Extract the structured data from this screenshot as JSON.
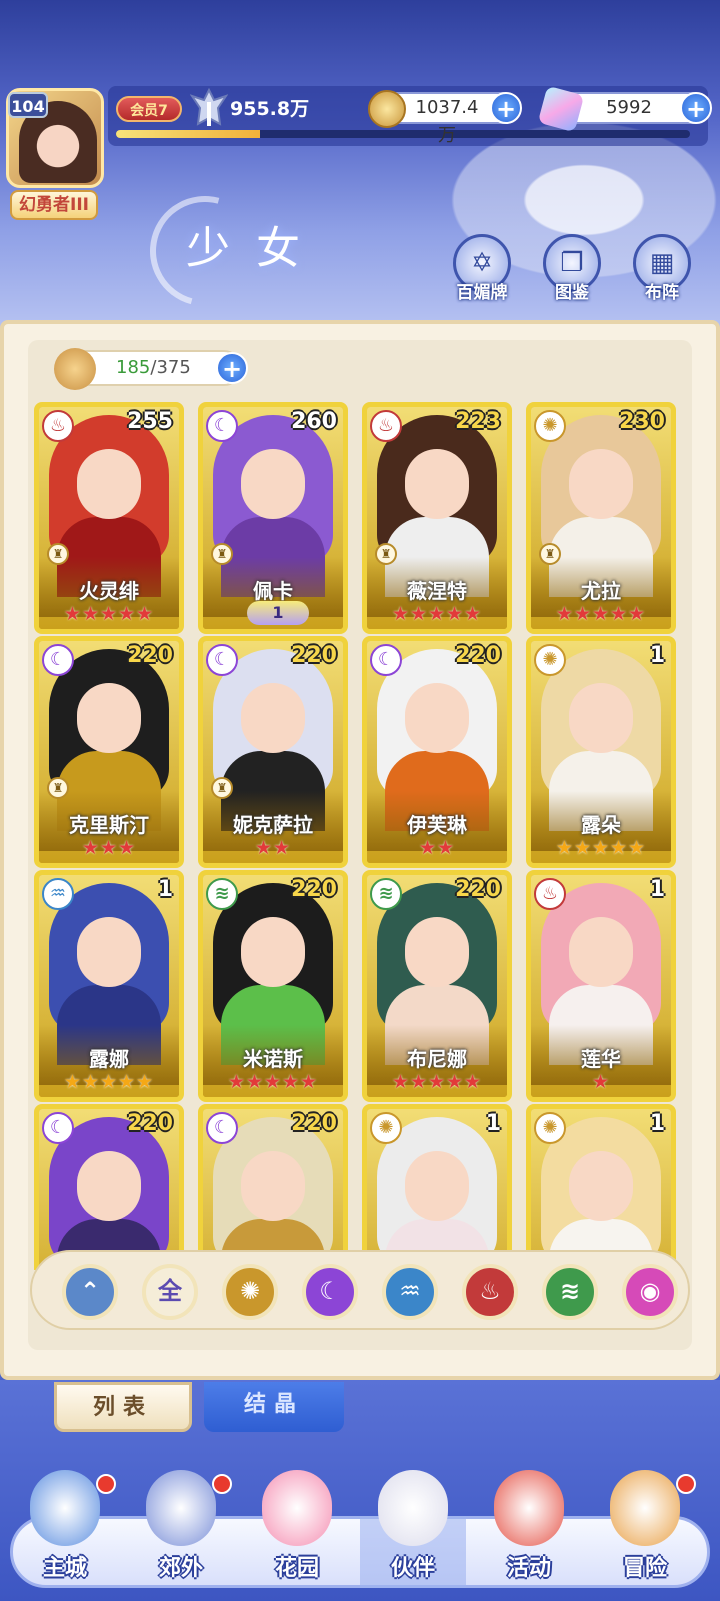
{
  "header": {
    "level": "104",
    "title_badge": "幻勇者III",
    "vip": "会员7",
    "power": "955.8万",
    "exp_progress": 0.25,
    "gold": "1037.4万",
    "gems": "5992",
    "plus": "+"
  },
  "banner": {
    "title": "少女",
    "buttons": [
      {
        "label": "百媚牌",
        "icon": "card-icon"
      },
      {
        "label": "图鉴",
        "icon": "book-icon"
      },
      {
        "label": "布阵",
        "icon": "grid-icon"
      }
    ]
  },
  "capacity": {
    "current": "185",
    "separator": "/",
    "max": "375"
  },
  "elements": {
    "fire": {
      "glyph": "♨",
      "color": "#c23a3a"
    },
    "moon": {
      "glyph": "☾",
      "color": "#8c45d6"
    },
    "sun": {
      "glyph": "✺",
      "color": "#c9972c"
    },
    "water": {
      "glyph": "♒",
      "color": "#3b86c9"
    },
    "wind": {
      "glyph": "≋",
      "color": "#3f9a4c"
    }
  },
  "cards": [
    {
      "name": "火灵绯",
      "level": "255",
      "element": "fire",
      "stars": "★★★★★",
      "star_color": "red",
      "hair": "#d23c2c",
      "outfit": "#a01818"
    },
    {
      "name": "佩卡",
      "level": "260",
      "element": "moon",
      "stars": "",
      "tier": "1",
      "hair": "#8b5ad1",
      "outfit": "#6c3ca6"
    },
    {
      "name": "薇涅特",
      "level": "223",
      "element": "fire",
      "stars": "★★★★★",
      "star_color": "red",
      "hair": "#4a2a1c",
      "outfit": "#eeeeee"
    },
    {
      "name": "尤拉",
      "level": "230",
      "element": "sun",
      "stars": "★★★★★",
      "star_color": "red",
      "hair": "#e8c89a",
      "outfit": "#f4f0e8"
    },
    {
      "name": "克里斯汀",
      "level": "220",
      "element": "moon",
      "stars": "★★★",
      "star_color": "red",
      "hair": "#1e1e1e",
      "outfit": "#c79a1d"
    },
    {
      "name": "妮克萨拉",
      "level": "220",
      "element": "moon",
      "stars": "★★",
      "star_color": "red",
      "hair": "#dcdff0",
      "outfit": "#222222"
    },
    {
      "name": "伊芙琳",
      "level": "220",
      "element": "moon",
      "stars": "★★",
      "star_color": "red",
      "hair": "#f2f2f2",
      "outfit": "#e06b1c"
    },
    {
      "name": "露朵",
      "level": "1",
      "element": "sun",
      "stars": "★★★★★",
      "star_color": "gold",
      "hair": "#eed9a5",
      "outfit": "#f5f1ea"
    },
    {
      "name": "露娜",
      "level": "1",
      "element": "water",
      "stars": "★★★★★",
      "star_color": "gold",
      "hair": "#3c4fb0",
      "outfit": "#2b3688"
    },
    {
      "name": "米诺斯",
      "level": "220",
      "element": "wind",
      "stars": "★★★★★",
      "star_color": "red",
      "hair": "#1c1c1c",
      "outfit": "#5cbf4a"
    },
    {
      "name": "布尼娜",
      "level": "220",
      "element": "wind",
      "stars": "★★★★★",
      "star_color": "red",
      "hair": "#2f5c4f",
      "outfit": "#f3d9c8"
    },
    {
      "name": "莲华",
      "level": "1",
      "element": "fire",
      "stars": "★",
      "star_color": "red",
      "hair": "#f2a9b6",
      "outfit": "#f6f0ee"
    },
    {
      "name": "",
      "level": "220",
      "element": "moon",
      "stars": "",
      "hair": "#7a45c9",
      "outfit": "#3a2a6e"
    },
    {
      "name": "",
      "level": "220",
      "element": "moon",
      "stars": "",
      "hair": "#e6dcb8",
      "outfit": "#c89a3a"
    },
    {
      "name": "",
      "level": "1",
      "element": "sun",
      "stars": "",
      "hair": "#ececec",
      "outfit": "#f2e2e6"
    },
    {
      "name": "",
      "level": "1",
      "element": "sun",
      "stars": "",
      "hair": "#f3dca0",
      "outfit": "#f7f4ef"
    }
  ],
  "filters": [
    {
      "label": "",
      "icon": "up-arrow-icon",
      "color": "#5b88c9"
    },
    {
      "label": "全",
      "icon": "all-icon",
      "color": "#f5edd8"
    },
    {
      "label": "",
      "icon": "sun-icon",
      "color": "#c9972c"
    },
    {
      "label": "",
      "icon": "moon-icon",
      "color": "#8c45d6"
    },
    {
      "label": "",
      "icon": "water-icon",
      "color": "#3b86c9"
    },
    {
      "label": "",
      "icon": "fire-icon",
      "color": "#c23a3a"
    },
    {
      "label": "",
      "icon": "wind-icon",
      "color": "#3f9a4c"
    },
    {
      "label": "",
      "icon": "orb-icon",
      "color": "#d64ab8"
    }
  ],
  "tabs": {
    "list": "列表",
    "crystal": "结晶"
  },
  "nav": [
    {
      "label": "主城",
      "badge": true,
      "active": false
    },
    {
      "label": "郊外",
      "badge": true,
      "active": false
    },
    {
      "label": "花园",
      "badge": false,
      "active": false
    },
    {
      "label": "伙伴",
      "badge": false,
      "active": true
    },
    {
      "label": "活动",
      "badge": false,
      "active": false
    },
    {
      "label": "冒险",
      "badge": true,
      "active": false
    }
  ]
}
